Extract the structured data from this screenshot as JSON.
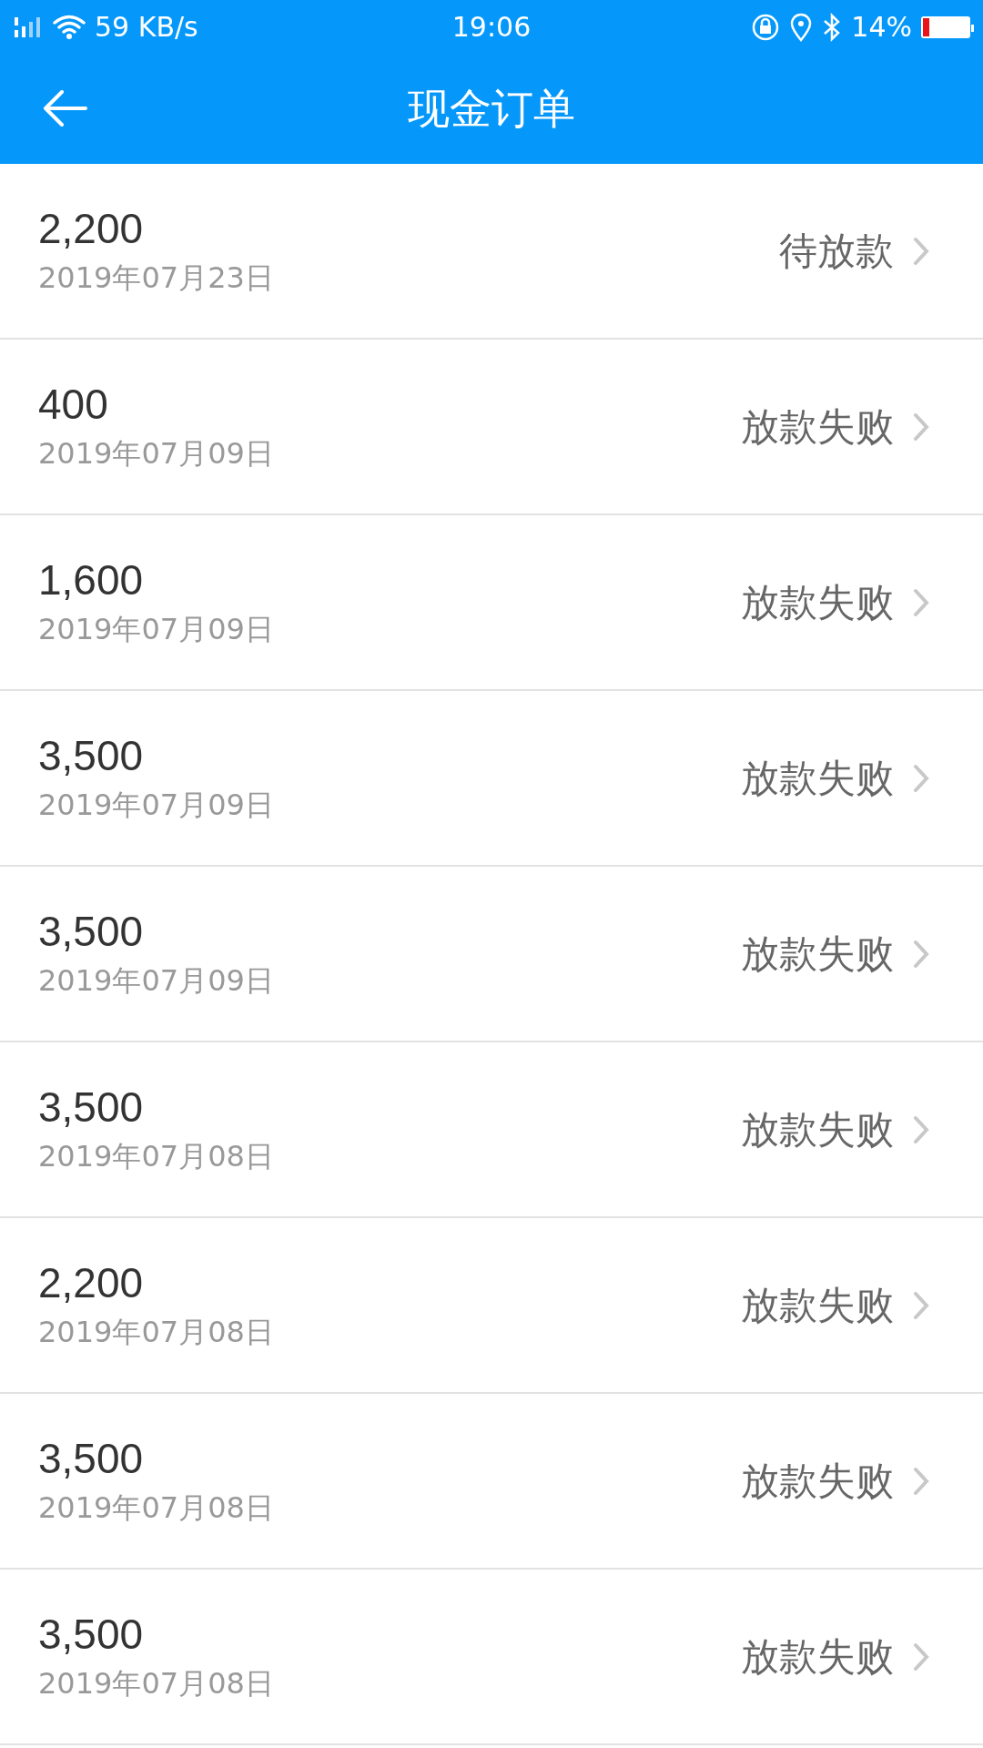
{
  "status_bar": {
    "network_speed": "59 KB/s",
    "time": "19:06",
    "battery_percent": "14%",
    "battery": {
      "level": 0.14
    }
  },
  "header": {
    "title": "现金订单"
  },
  "orders": [
    {
      "amount": "2,200",
      "date": "2019年07月23日",
      "status": "待放款"
    },
    {
      "amount": "400",
      "date": "2019年07月09日",
      "status": "放款失败"
    },
    {
      "amount": "1,600",
      "date": "2019年07月09日",
      "status": "放款失败"
    },
    {
      "amount": "3,500",
      "date": "2019年07月09日",
      "status": "放款失败"
    },
    {
      "amount": "3,500",
      "date": "2019年07月09日",
      "status": "放款失败"
    },
    {
      "amount": "3,500",
      "date": "2019年07月08日",
      "status": "放款失败"
    },
    {
      "amount": "2,200",
      "date": "2019年07月08日",
      "status": "放款失败"
    },
    {
      "amount": "3,500",
      "date": "2019年07月08日",
      "status": "放款失败"
    },
    {
      "amount": "3,500",
      "date": "2019年07月08日",
      "status": "放款失败"
    }
  ]
}
